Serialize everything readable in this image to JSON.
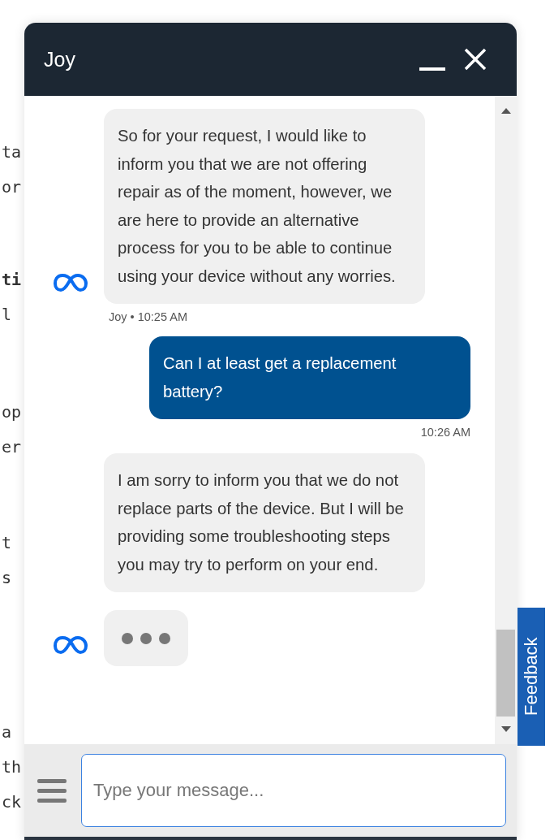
{
  "page_fragments": [
    {
      "text": "ta",
      "bold": false
    },
    {
      "text": "or",
      "bold": false
    },
    {
      "text": "ti",
      "bold": true
    },
    {
      "text": "l",
      "bold": false
    },
    {
      "text": "op",
      "bold": false
    },
    {
      "text": "er",
      "bold": false
    },
    {
      "text": "t",
      "bold": false
    },
    {
      "text": "s",
      "bold": false
    },
    {
      "text": "a",
      "bold": false
    },
    {
      "text": "th",
      "bold": false
    },
    {
      "text": "ck",
      "bold": false
    }
  ],
  "chat": {
    "title": "Joy",
    "messages": [
      {
        "kind": "bot",
        "avatar": true,
        "text": "So for your request, I would like to inform you that we are not offering repair as of the moment, however, we are here to provide an alternative process for you to be able to continue using your device without any worries.",
        "meta": "Joy • 10:25 AM"
      },
      {
        "kind": "user",
        "text": "Can I at least get a replacement battery?",
        "meta": "10:26 AM"
      },
      {
        "kind": "bot",
        "avatar": false,
        "text": "I am sorry to inform you that we do not replace parts of the device. But I will be providing some troubleshooting steps you may try to perform on your end."
      },
      {
        "kind": "typing",
        "avatar": true
      }
    ],
    "input": {
      "placeholder": "Type your message..."
    }
  },
  "feedback_tab": {
    "label": "Feedback"
  }
}
